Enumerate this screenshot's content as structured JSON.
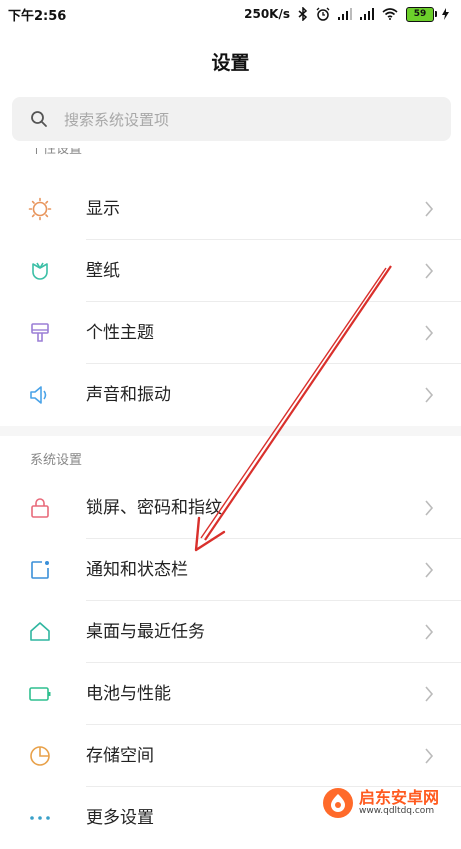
{
  "statusbar": {
    "time": "下午2:56",
    "speed": "250K/s",
    "battery": "59"
  },
  "header": {
    "title": "设置"
  },
  "search": {
    "placeholder": "搜索系统设置项"
  },
  "sections": {
    "personal": "个性设置",
    "system": "系统设置"
  },
  "personal_items": [
    {
      "label": "显示",
      "icon": "sun-icon",
      "color": "#e8955c"
    },
    {
      "label": "壁纸",
      "icon": "tulip-icon",
      "color": "#3bbfa6"
    },
    {
      "label": "个性主题",
      "icon": "brush-icon",
      "color": "#9b7fd6"
    },
    {
      "label": "声音和振动",
      "icon": "speaker-icon",
      "color": "#4aa3e8"
    }
  ],
  "system_items": [
    {
      "label": "锁屏、密码和指纹",
      "icon": "lock-icon",
      "color": "#e86a7a"
    },
    {
      "label": "通知和状态栏",
      "icon": "notification-icon",
      "color": "#3a8fd8"
    },
    {
      "label": "桌面与最近任务",
      "icon": "home-icon",
      "color": "#2fb6a0"
    },
    {
      "label": "电池与性能",
      "icon": "battery-icon",
      "color": "#2fbf8f"
    },
    {
      "label": "存储空间",
      "icon": "pie-chart-icon",
      "color": "#e8a14a"
    },
    {
      "label": "更多设置",
      "icon": "more-dots-icon",
      "color": "#3aa0c8"
    }
  ],
  "watermark": {
    "title": "启东安卓网",
    "url": "www.qdltdq.com"
  }
}
